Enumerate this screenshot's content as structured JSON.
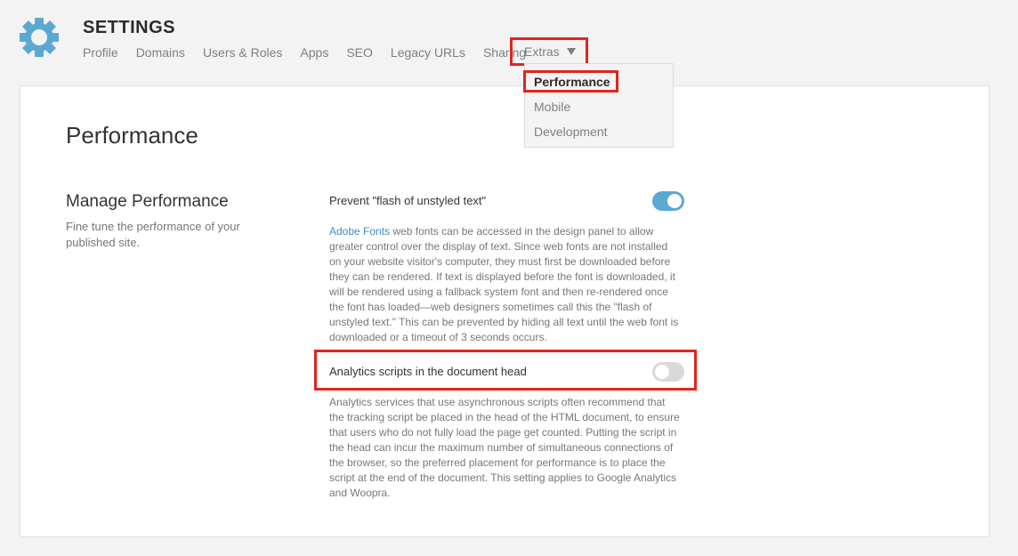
{
  "header": {
    "title": "SETTINGS",
    "nav": [
      "Profile",
      "Domains",
      "Users & Roles",
      "Apps",
      "SEO",
      "Legacy URLs",
      "Sharing"
    ],
    "extras_label": "Extras"
  },
  "dropdown": {
    "items": [
      "Performance",
      "Mobile",
      "Development"
    ],
    "selected": "Performance"
  },
  "page": {
    "title": "Performance",
    "section_title": "Manage Performance",
    "section_desc": "Fine tune the performance of your published site."
  },
  "settings": [
    {
      "label": "Prevent \"flash of unstyled text\"",
      "enabled": true,
      "link_text": "Adobe Fonts",
      "description": " web fonts can be accessed in the design panel to allow greater control over the display of text. Since web fonts are not installed on your website visitor's computer, they must first be downloaded before they can be rendered. If text is displayed before the font is downloaded, it will be rendered using a fallback system font and then re-rendered once the font has loaded—web designers sometimes call this the \"flash of unstyled text.\" This can be prevented by hiding all text until the web font is downloaded or a timeout of 3 seconds occurs."
    },
    {
      "label": "Analytics scripts in the document head",
      "enabled": false,
      "description": "Analytics services that use asynchronous scripts often recommend that the tracking script be placed in the head of the HTML document, to ensure that users who do not fully load the page get counted. Putting the script in the head can incur the maximum number of simultaneous connections of the browser, so the preferred placement for performance is to place the script at the end of the document. This setting applies to Google Analytics and Woopra."
    }
  ],
  "colors": {
    "accent": "#5aa9d3",
    "highlight": "#e0251b",
    "link": "#3b8cc8"
  }
}
